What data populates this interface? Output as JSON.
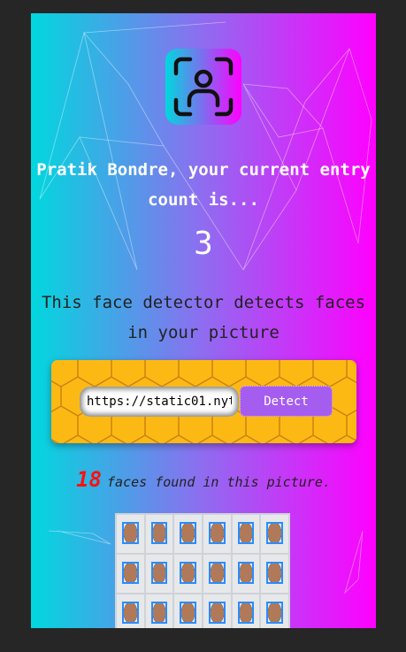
{
  "app": {
    "logo_icon": "face-id-icon"
  },
  "header": {
    "title": "Pratik Bondre, your current entry count is...",
    "count": "3"
  },
  "description": "This face detector detects faces in your picture",
  "form": {
    "url_value": "https://static01.nyt",
    "detect_label": "Detect"
  },
  "result": {
    "count": "18",
    "text": "faces found in this picture."
  },
  "image": {
    "faces_shown": 18
  },
  "colors": {
    "gradient_start": "#00d8de",
    "gradient_end": "#ff00ff",
    "box": "#fdb913",
    "button": "#a55df0",
    "count": "#ff1010"
  }
}
